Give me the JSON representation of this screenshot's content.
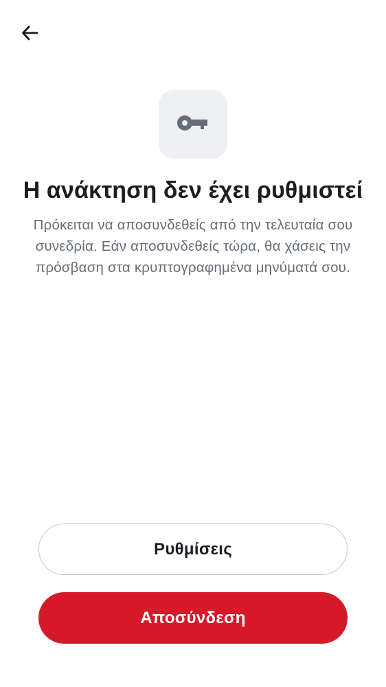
{
  "header": {
    "back_icon": "arrow-left-icon"
  },
  "hero": {
    "icon": "key-icon",
    "tile_color": "#eff0f4"
  },
  "title": "Η ανάκτηση δεν έχει ρυθμιστεί",
  "description": "Πρόκειται να αποσυνδεθείς από την τελευταία σου συνεδρία. Εάν αποσυνδεθείς τώρα, θα χάσεις την πρόσβαση στα κρυπτογραφημένα μηνύματά σου.",
  "actions": {
    "settings_label": "Ρυθμίσεις",
    "logout_label": "Αποσύνδεση"
  },
  "colors": {
    "accent": "#d51928",
    "title_text": "#1b1d22",
    "body_text": "#656d77",
    "outline": "#c4c7cc"
  }
}
